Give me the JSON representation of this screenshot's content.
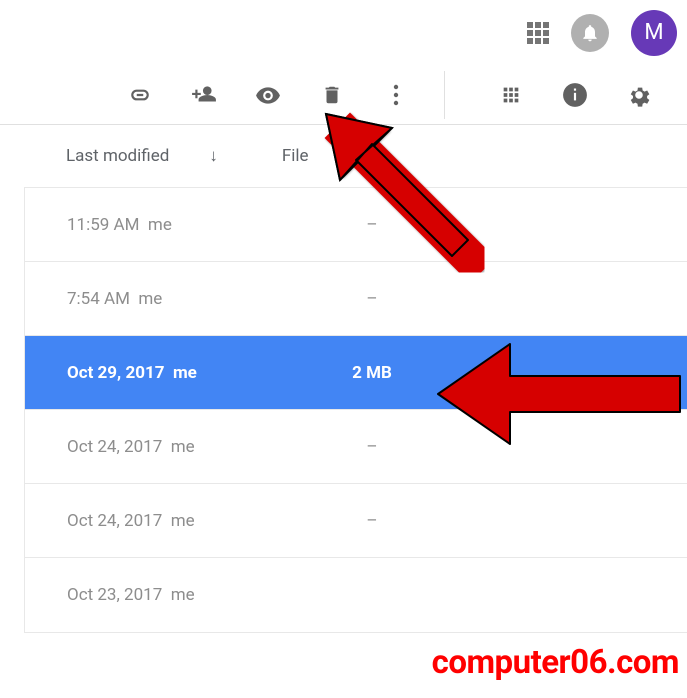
{
  "topbar": {
    "avatar_letter": "M"
  },
  "list_header": {
    "col_modified": "Last modified",
    "sort_icon": "↓",
    "col_size": "File"
  },
  "rows": [
    {
      "modified": "11:59 AM",
      "owner": "me",
      "size": "–",
      "selected": false
    },
    {
      "modified": "7:54 AM",
      "owner": "me",
      "size": "–",
      "selected": false
    },
    {
      "modified": "Oct 29, 2017",
      "owner": "me",
      "size": "2 MB",
      "selected": true
    },
    {
      "modified": "Oct 24, 2017",
      "owner": "me",
      "size": "–",
      "selected": false
    },
    {
      "modified": "Oct 24, 2017",
      "owner": "me",
      "size": "–",
      "selected": false
    },
    {
      "modified": "Oct 23, 2017",
      "owner": "me",
      "size": "",
      "selected": false
    }
  ],
  "watermark": "computer06.com"
}
